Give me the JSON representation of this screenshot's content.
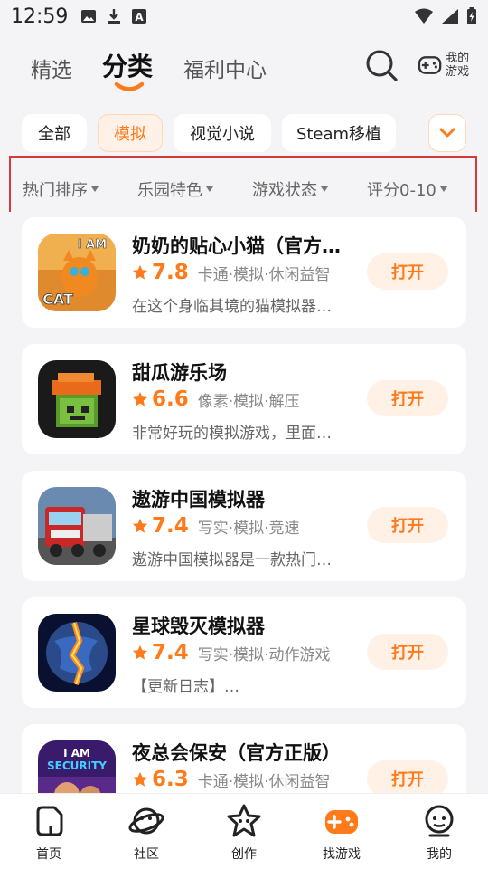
{
  "status_bar": {
    "time": "12:59"
  },
  "top_tabs": [
    {
      "label": "精选",
      "active": false
    },
    {
      "label": "分类",
      "active": true
    },
    {
      "label": "福利中心",
      "active": false
    }
  ],
  "my_games_label": "我的游戏",
  "category_chips": [
    {
      "label": "全部",
      "active": false
    },
    {
      "label": "模拟",
      "active": true
    },
    {
      "label": "视觉小说",
      "active": false
    },
    {
      "label": "Steam移植",
      "active": false
    }
  ],
  "filters": [
    {
      "label": "热门排序"
    },
    {
      "label": "乐园特色"
    },
    {
      "label": "游戏状态"
    },
    {
      "label": "评分0-10"
    }
  ],
  "games": [
    {
      "title": "奶奶的贴心小猫（官方…",
      "rating": "7.8",
      "tags": "卡通·模拟·休闲益智",
      "desc": "在这个身临其境的猫模拟器…",
      "button": "打开",
      "icon": "cat-game-icon"
    },
    {
      "title": "甜瓜游乐场",
      "rating": "6.6",
      "tags": "像素·模拟·解压",
      "desc": "非常好玩的模拟游戏，里面…",
      "button": "打开",
      "icon": "melon-game-icon"
    },
    {
      "title": "遨游中国模拟器",
      "rating": "7.4",
      "tags": "写实·模拟·竞速",
      "desc": "遨游中国模拟器是一款热门…",
      "button": "打开",
      "icon": "truck-game-icon"
    },
    {
      "title": "星球毁灭模拟器",
      "rating": "7.4",
      "tags": "写实·模拟·动作游戏",
      "desc": "【更新日志】…",
      "button": "打开",
      "icon": "planet-game-icon"
    },
    {
      "title": "夜总会保安（官方正版）",
      "rating": "6.3",
      "tags": "卡通·模拟·休闲益智",
      "desc": "",
      "button": "打开",
      "icon": "security-game-icon"
    }
  ],
  "bottom_nav": [
    {
      "label": "首页",
      "icon": "home-icon",
      "active": false
    },
    {
      "label": "社区",
      "icon": "planet-icon",
      "active": false
    },
    {
      "label": "创作",
      "icon": "create-icon",
      "active": false
    },
    {
      "label": "找游戏",
      "icon": "gamepad-icon",
      "active": true
    },
    {
      "label": "我的",
      "icon": "profile-icon",
      "active": false
    }
  ],
  "colors": {
    "accent": "#ff7a1a",
    "highlight_outline": "#d43a3a"
  }
}
